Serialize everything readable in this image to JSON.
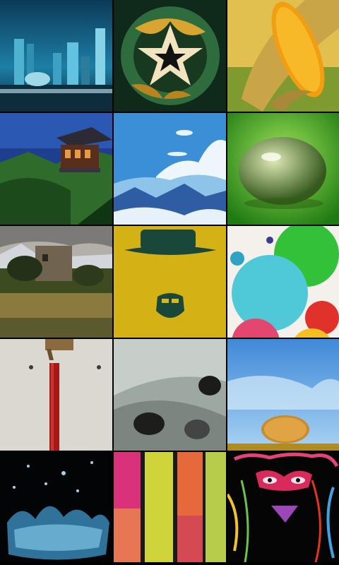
{
  "gallery": {
    "tiles": [
      {
        "icon": "futuristic-city-wallpaper"
      },
      {
        "icon": "abstract-star-wallpaper"
      },
      {
        "icon": "corn-cob-wallpaper"
      },
      {
        "icon": "pagoda-mountain-wallpaper"
      },
      {
        "icon": "sky-clouds-wallpaper"
      },
      {
        "icon": "earth-water-drop-wallpaper"
      },
      {
        "icon": "stone-house-landscape-wallpaper"
      },
      {
        "icon": "hat-beard-silhouette-wallpaper"
      },
      {
        "icon": "colorful-circles-wallpaper"
      },
      {
        "icon": "firecracker-wall-wallpaper"
      },
      {
        "icon": "frost-texture-wallpaper"
      },
      {
        "icon": "hay-bale-field-wallpaper"
      },
      {
        "icon": "water-splash-wallpaper"
      },
      {
        "icon": "painted-wood-planks-wallpaper"
      },
      {
        "icon": "carnival-mask-face-wallpaper"
      }
    ]
  },
  "colors": {
    "background": "#000000"
  }
}
